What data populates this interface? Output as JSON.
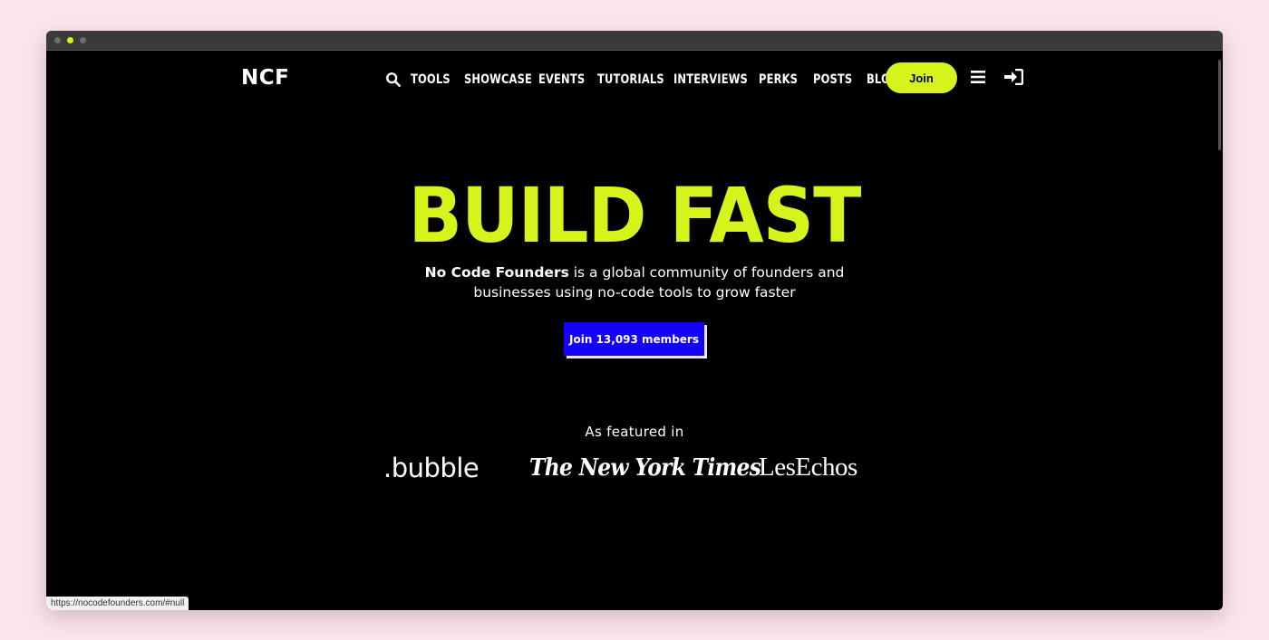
{
  "brand": {
    "logo": "NCF",
    "accent": "#d6f31c",
    "cta_color": "#1400ff"
  },
  "nav": {
    "search_icon": "search-icon",
    "items": [
      "TOOLS",
      "SHOWCASE",
      "EVENTS",
      "TUTORIALS",
      "INTERVIEWS",
      "PERKS",
      "POSTS",
      "BLOG"
    ],
    "join_label": "Join",
    "menu_icon": "hamburger-menu-icon",
    "login_icon": "sign-in-icon"
  },
  "hero": {
    "title": "BUILD FAST",
    "subtitle_bold": "No Code Founders",
    "subtitle_rest_line1": " is a global community of founders and",
    "subtitle_line2": "businesses using no-code tools to grow faster",
    "cta_label": "Join 13,093 members"
  },
  "featured": {
    "label": "As featured in",
    "logos": [
      ".bubble",
      "The New York Times",
      "LesEchos"
    ]
  },
  "status_bar": {
    "url": "https://nocodefounders.com/#null"
  }
}
